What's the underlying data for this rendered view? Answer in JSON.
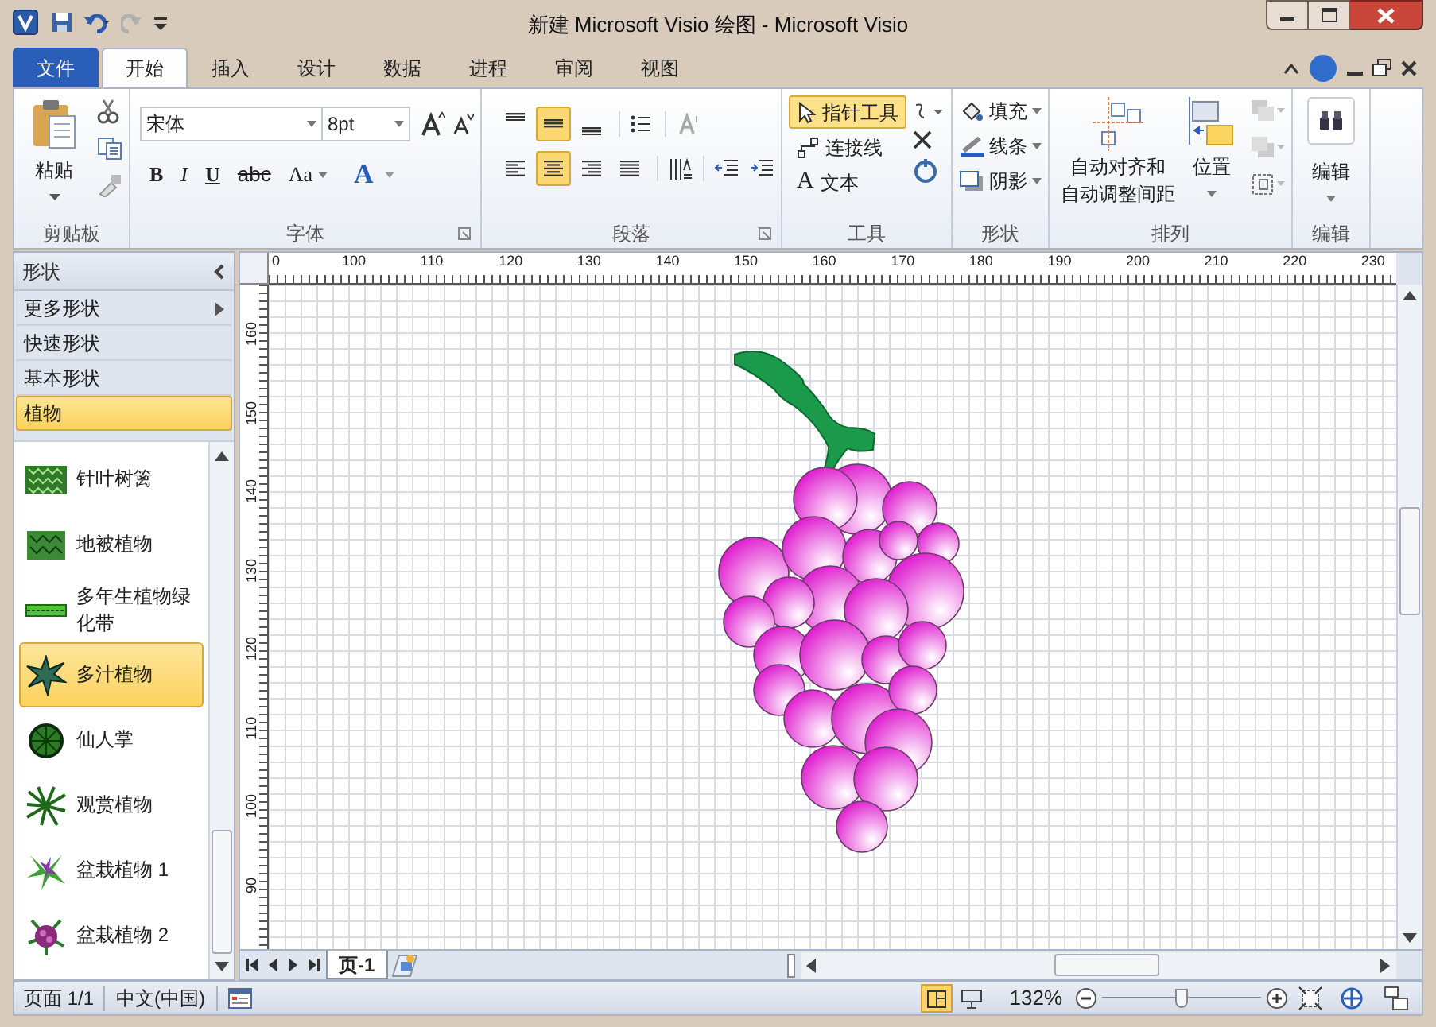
{
  "window": {
    "title": "新建 Microsoft Visio 绘图 - Microsoft Visio"
  },
  "menu_tabs": [
    {
      "label": "文件",
      "kind": "file",
      "selected": false
    },
    {
      "label": "开始",
      "kind": "tab",
      "selected": true
    },
    {
      "label": "插入",
      "kind": "tab",
      "selected": false
    },
    {
      "label": "设计",
      "kind": "tab",
      "selected": false
    },
    {
      "label": "数据",
      "kind": "tab",
      "selected": false
    },
    {
      "label": "进程",
      "kind": "tab",
      "selected": false
    },
    {
      "label": "审阅",
      "kind": "tab",
      "selected": false
    },
    {
      "label": "视图",
      "kind": "tab",
      "selected": false
    }
  ],
  "ribbon": {
    "clipboard": {
      "label": "剪贴板",
      "paste": "粘贴"
    },
    "font": {
      "label": "字体",
      "font_name": "宋体",
      "font_size": "8pt",
      "format_buttons": [
        "B",
        "I",
        "U",
        "abc",
        "Aa"
      ],
      "color_button": "A"
    },
    "paragraph": {
      "label": "段落",
      "vertical_align": [
        {
          "selected": false
        },
        {
          "selected": true
        },
        {
          "selected": false
        }
      ],
      "horizontal_align": [
        {
          "selected": false
        },
        {
          "selected": true
        },
        {
          "selected": false
        },
        {
          "selected": false
        }
      ]
    },
    "tools": {
      "label": "工具",
      "items": [
        {
          "label": "指针工具",
          "kind": "pointer",
          "selected": true
        },
        {
          "label": "连接线",
          "kind": "connector",
          "selected": false
        },
        {
          "label": "文本",
          "kind": "text",
          "glyph": "A",
          "selected": false
        }
      ]
    },
    "shape": {
      "label": "形状",
      "items": [
        {
          "label": "填充",
          "kind": "fill"
        },
        {
          "label": "线条",
          "kind": "line"
        },
        {
          "label": "阴影",
          "kind": "shadow"
        }
      ]
    },
    "arrange": {
      "label": "排列",
      "auto_align": [
        "自动对齐和",
        "自动调整间距"
      ],
      "position": "位置"
    },
    "editing": {
      "label": "编辑",
      "button": "编辑"
    }
  },
  "shapes_panel": {
    "title": "形状",
    "categories": [
      {
        "label": "更多形状",
        "kind": "more",
        "selected": false
      },
      {
        "label": "快速形状",
        "kind": "plain",
        "selected": false
      },
      {
        "label": "基本形状",
        "kind": "plain",
        "selected": false
      },
      {
        "label": "植物",
        "kind": "plain",
        "selected": true
      }
    ],
    "stencil": [
      {
        "label": "针叶树篱",
        "kind": "hedge",
        "selected": false
      },
      {
        "label": "地被植物",
        "kind": "groundcover",
        "selected": false
      },
      {
        "label": "多年生植物绿化带",
        "kind": "border",
        "selected": false
      },
      {
        "label": "多汁植物",
        "kind": "succulent",
        "selected": true
      },
      {
        "label": "仙人掌",
        "kind": "cactus",
        "selected": false
      },
      {
        "label": "观赏植物",
        "kind": "ornamental",
        "selected": false
      },
      {
        "label": "盆栽植物 1",
        "kind": "potted1",
        "selected": false
      },
      {
        "label": "盆栽植物 2",
        "kind": "potted2",
        "selected": false
      }
    ]
  },
  "rulers": {
    "horizontal": [
      "0",
      "100",
      "110",
      "120",
      "130",
      "140",
      "150",
      "160",
      "170",
      "180",
      "190",
      "200",
      "210",
      "220",
      "230"
    ],
    "vertical": [
      "160",
      "150",
      "140",
      "130",
      "120",
      "110",
      "100",
      "90"
    ]
  },
  "page_tabs": [
    {
      "label": "页-1",
      "selected": true
    }
  ],
  "status_bar": {
    "page": "页面 1/1",
    "language": "中文(中国)",
    "zoom": "132%",
    "zoom_slider": {
      "level": 0.5
    }
  }
}
